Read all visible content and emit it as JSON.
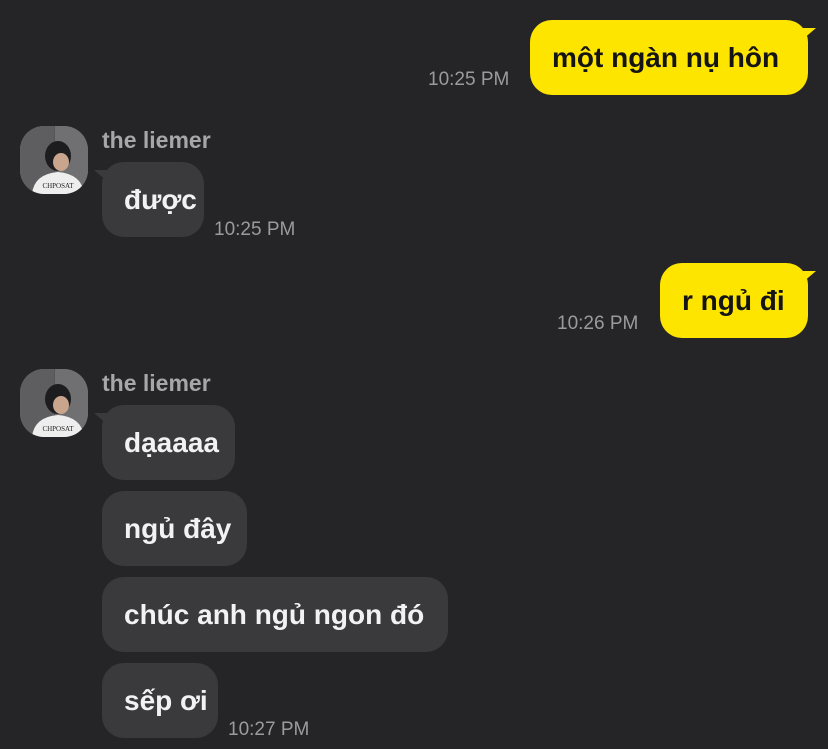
{
  "chat": {
    "messages": [
      {
        "direction": "out",
        "text": "một ngàn nụ hôn",
        "time": "10:25 PM"
      },
      {
        "direction": "in",
        "sender": "the liemer",
        "text": "được",
        "time": "10:25 PM"
      },
      {
        "direction": "out",
        "text": "r ngủ đi",
        "time": "10:26 PM"
      },
      {
        "direction": "in",
        "sender": "the liemer",
        "texts": [
          "dạaaaa",
          "ngủ đây",
          "chúc anh ngủ ngon đó",
          "sếp ơi"
        ],
        "time": "10:27 PM"
      }
    ]
  },
  "avatar": {
    "shirt_text": "CHPOSAT",
    "icon": "profile-photo-avatar"
  },
  "colors": {
    "background": "#252527",
    "outgoing_bubble": "#fee500",
    "incoming_bubble": "#3a3a3c",
    "timestamp": "#9b9b9e"
  }
}
